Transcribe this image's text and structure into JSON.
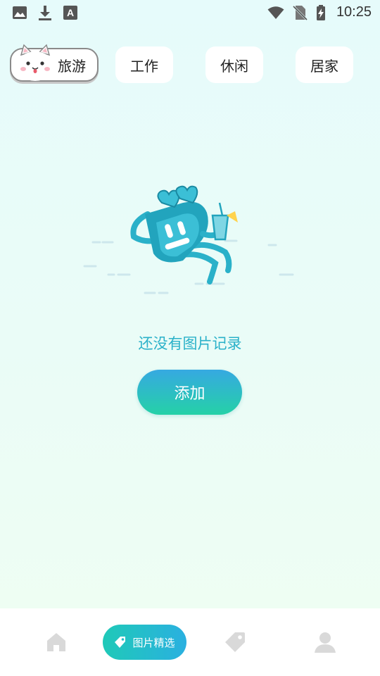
{
  "status_bar": {
    "time": "10:25",
    "icons": [
      "image-icon",
      "download-icon",
      "font-a-icon",
      "wifi-icon",
      "no-sim-icon",
      "battery-charging-icon"
    ]
  },
  "categories": [
    {
      "label": "旅游",
      "active": true
    },
    {
      "label": "工作",
      "active": false
    },
    {
      "label": "休闲",
      "active": false
    },
    {
      "label": "居家",
      "active": false
    }
  ],
  "empty_state": {
    "message": "还没有图片记录",
    "add_button_label": "添加"
  },
  "bottom_nav": {
    "items": [
      {
        "icon": "home-icon",
        "label": ""
      },
      {
        "icon": "tag-icon",
        "label": "图片精选",
        "active": true
      },
      {
        "icon": "label-icon",
        "label": ""
      },
      {
        "icon": "user-icon",
        "label": ""
      }
    ]
  },
  "colors": {
    "accent_teal": "#2ab1c9",
    "button_gradient_start": "#36a9e1",
    "button_gradient_end": "#25d1a7",
    "inactive_icon": "#d9d9d9"
  }
}
